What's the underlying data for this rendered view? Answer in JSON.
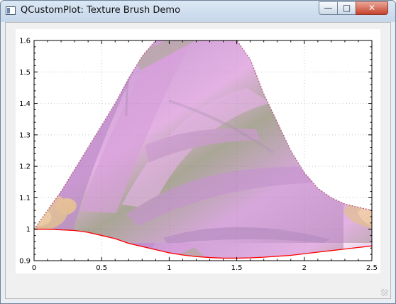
{
  "window": {
    "title": "QCustomPlot: Texture Brush Demo",
    "buttons": {
      "minimize": "—",
      "maximize": "□",
      "close": "✕"
    },
    "icon": "app-window-icon"
  },
  "chart_data": {
    "type": "line",
    "title": "",
    "xlabel": "",
    "ylabel": "",
    "xlim": [
      0,
      2.5
    ],
    "ylim": [
      0.9,
      1.6
    ],
    "x_ticks": [
      "0",
      "0.5",
      "1",
      "1.5",
      "2",
      "2.5"
    ],
    "y_ticks": [
      "0.9",
      "1",
      "1.1",
      "1.2",
      "1.3",
      "1.4",
      "1.5",
      "1.6"
    ],
    "grid": true,
    "series": [
      {
        "name": "",
        "style": "dotted",
        "color": "#b65c7e",
        "x": [
          0,
          0.1,
          0.2,
          0.3,
          0.4,
          0.5,
          0.6,
          0.7,
          0.8,
          0.9,
          1.0,
          1.1,
          1.2,
          1.3,
          1.4,
          1.5,
          1.6,
          1.7,
          1.8,
          1.9,
          2.0,
          2.1,
          2.2,
          2.3,
          2.4,
          2.5
        ],
        "y": [
          1.0,
          1.06,
          1.12,
          1.19,
          1.26,
          1.33,
          1.4,
          1.48,
          1.55,
          1.6,
          1.6,
          1.6,
          1.6,
          1.6,
          1.6,
          1.6,
          1.54,
          1.43,
          1.34,
          1.25,
          1.18,
          1.13,
          1.1,
          1.08,
          1.07,
          1.06
        ]
      },
      {
        "name": "",
        "style": "solid",
        "color": "#ff0000",
        "x": [
          0,
          0.1,
          0.2,
          0.3,
          0.4,
          0.5,
          0.6,
          0.7,
          0.8,
          0.9,
          1.0,
          1.1,
          1.2,
          1.3,
          1.4,
          1.5,
          1.6,
          1.7,
          1.8,
          1.9,
          2.0,
          2.1,
          2.2,
          2.3,
          2.4,
          2.5
        ],
        "y": [
          1.0,
          1.0,
          0.998,
          0.996,
          0.99,
          0.98,
          0.97,
          0.955,
          0.945,
          0.935,
          0.925,
          0.918,
          0.913,
          0.91,
          0.908,
          0.908,
          0.909,
          0.911,
          0.914,
          0.917,
          0.922,
          0.927,
          0.932,
          0.937,
          0.942,
          0.947
        ]
      }
    ],
    "fill": {
      "between": [
        0,
        1
      ],
      "style": "texture-brush",
      "colors": [
        "#b070b5",
        "#8a4aa1",
        "#d48ad4",
        "#7d7a63",
        "#d9a24c"
      ],
      "opacity": 0.66
    }
  }
}
